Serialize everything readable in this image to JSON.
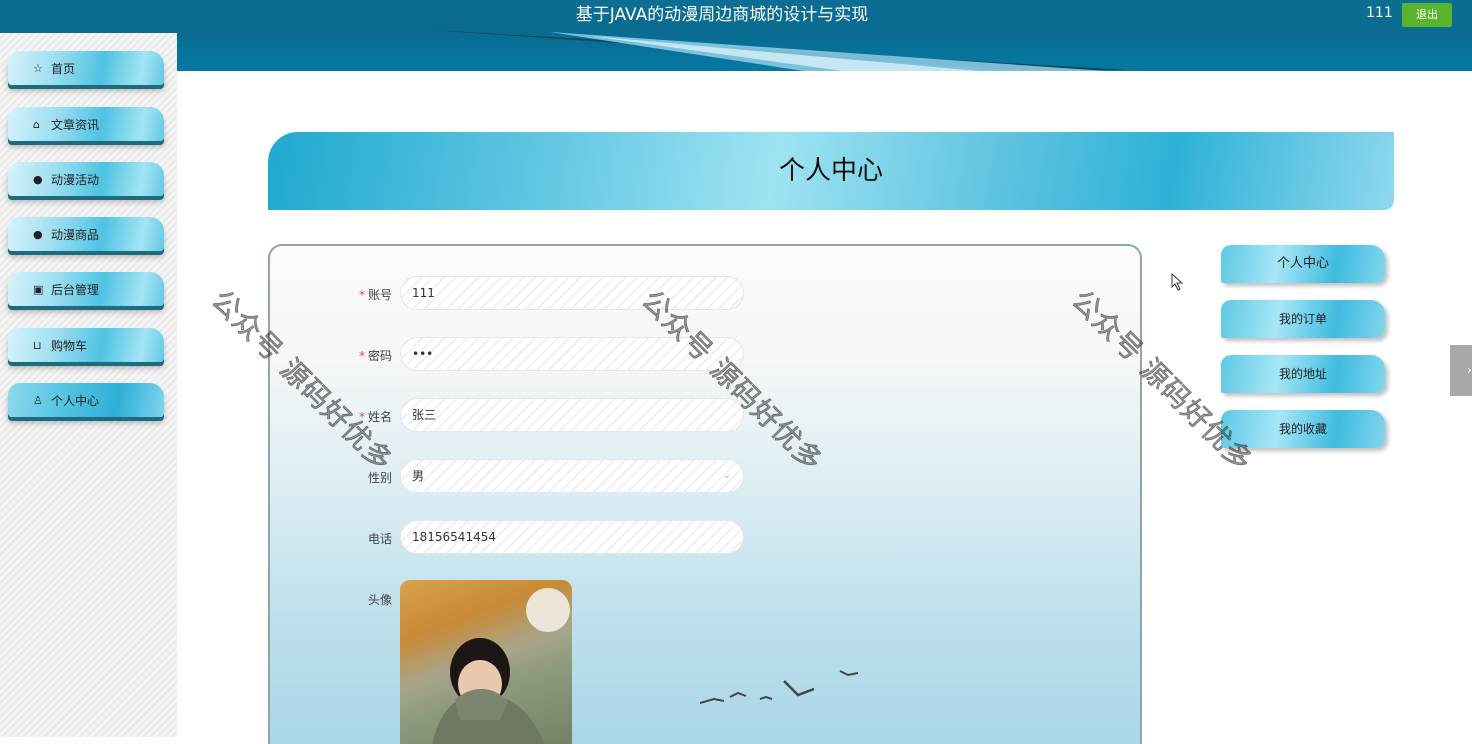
{
  "header": {
    "title": "基于JAVA的动漫周边商城的设计与实现",
    "username": "111",
    "logout_label": "退出"
  },
  "sidebar": {
    "items": [
      {
        "label": "首页",
        "icon": "star-icon"
      },
      {
        "label": "文章资讯",
        "icon": "bag-icon"
      },
      {
        "label": "动漫活动",
        "icon": "exclamation-circle-icon"
      },
      {
        "label": "动漫商品",
        "icon": "question-circle-icon"
      },
      {
        "label": "后台管理",
        "icon": "briefcase-icon"
      },
      {
        "label": "购物车",
        "icon": "cart-icon"
      },
      {
        "label": "个人中心",
        "icon": "user-icon",
        "active": true
      }
    ]
  },
  "page": {
    "title": "个人中心"
  },
  "form": {
    "account": {
      "label": "账号",
      "value": "111",
      "required": true
    },
    "password": {
      "label": "密码",
      "value": "•••",
      "required": true
    },
    "name": {
      "label": "姓名",
      "value": "张三",
      "required": true
    },
    "gender": {
      "label": "性别",
      "value": "男"
    },
    "phone": {
      "label": "电话",
      "value": "18156541454"
    },
    "avatar": {
      "label": "头像"
    }
  },
  "right_menu": {
    "items": [
      {
        "label": "个人中心"
      },
      {
        "label": "我的订单"
      },
      {
        "label": "我的地址"
      },
      {
        "label": "我的收藏"
      }
    ]
  },
  "watermark": "公众号 源码好优多",
  "colors": {
    "header_bg": "#0a6b90",
    "logout_bg": "#59b32d",
    "accent": "#3fbbdf",
    "required": "#e24a4a"
  }
}
